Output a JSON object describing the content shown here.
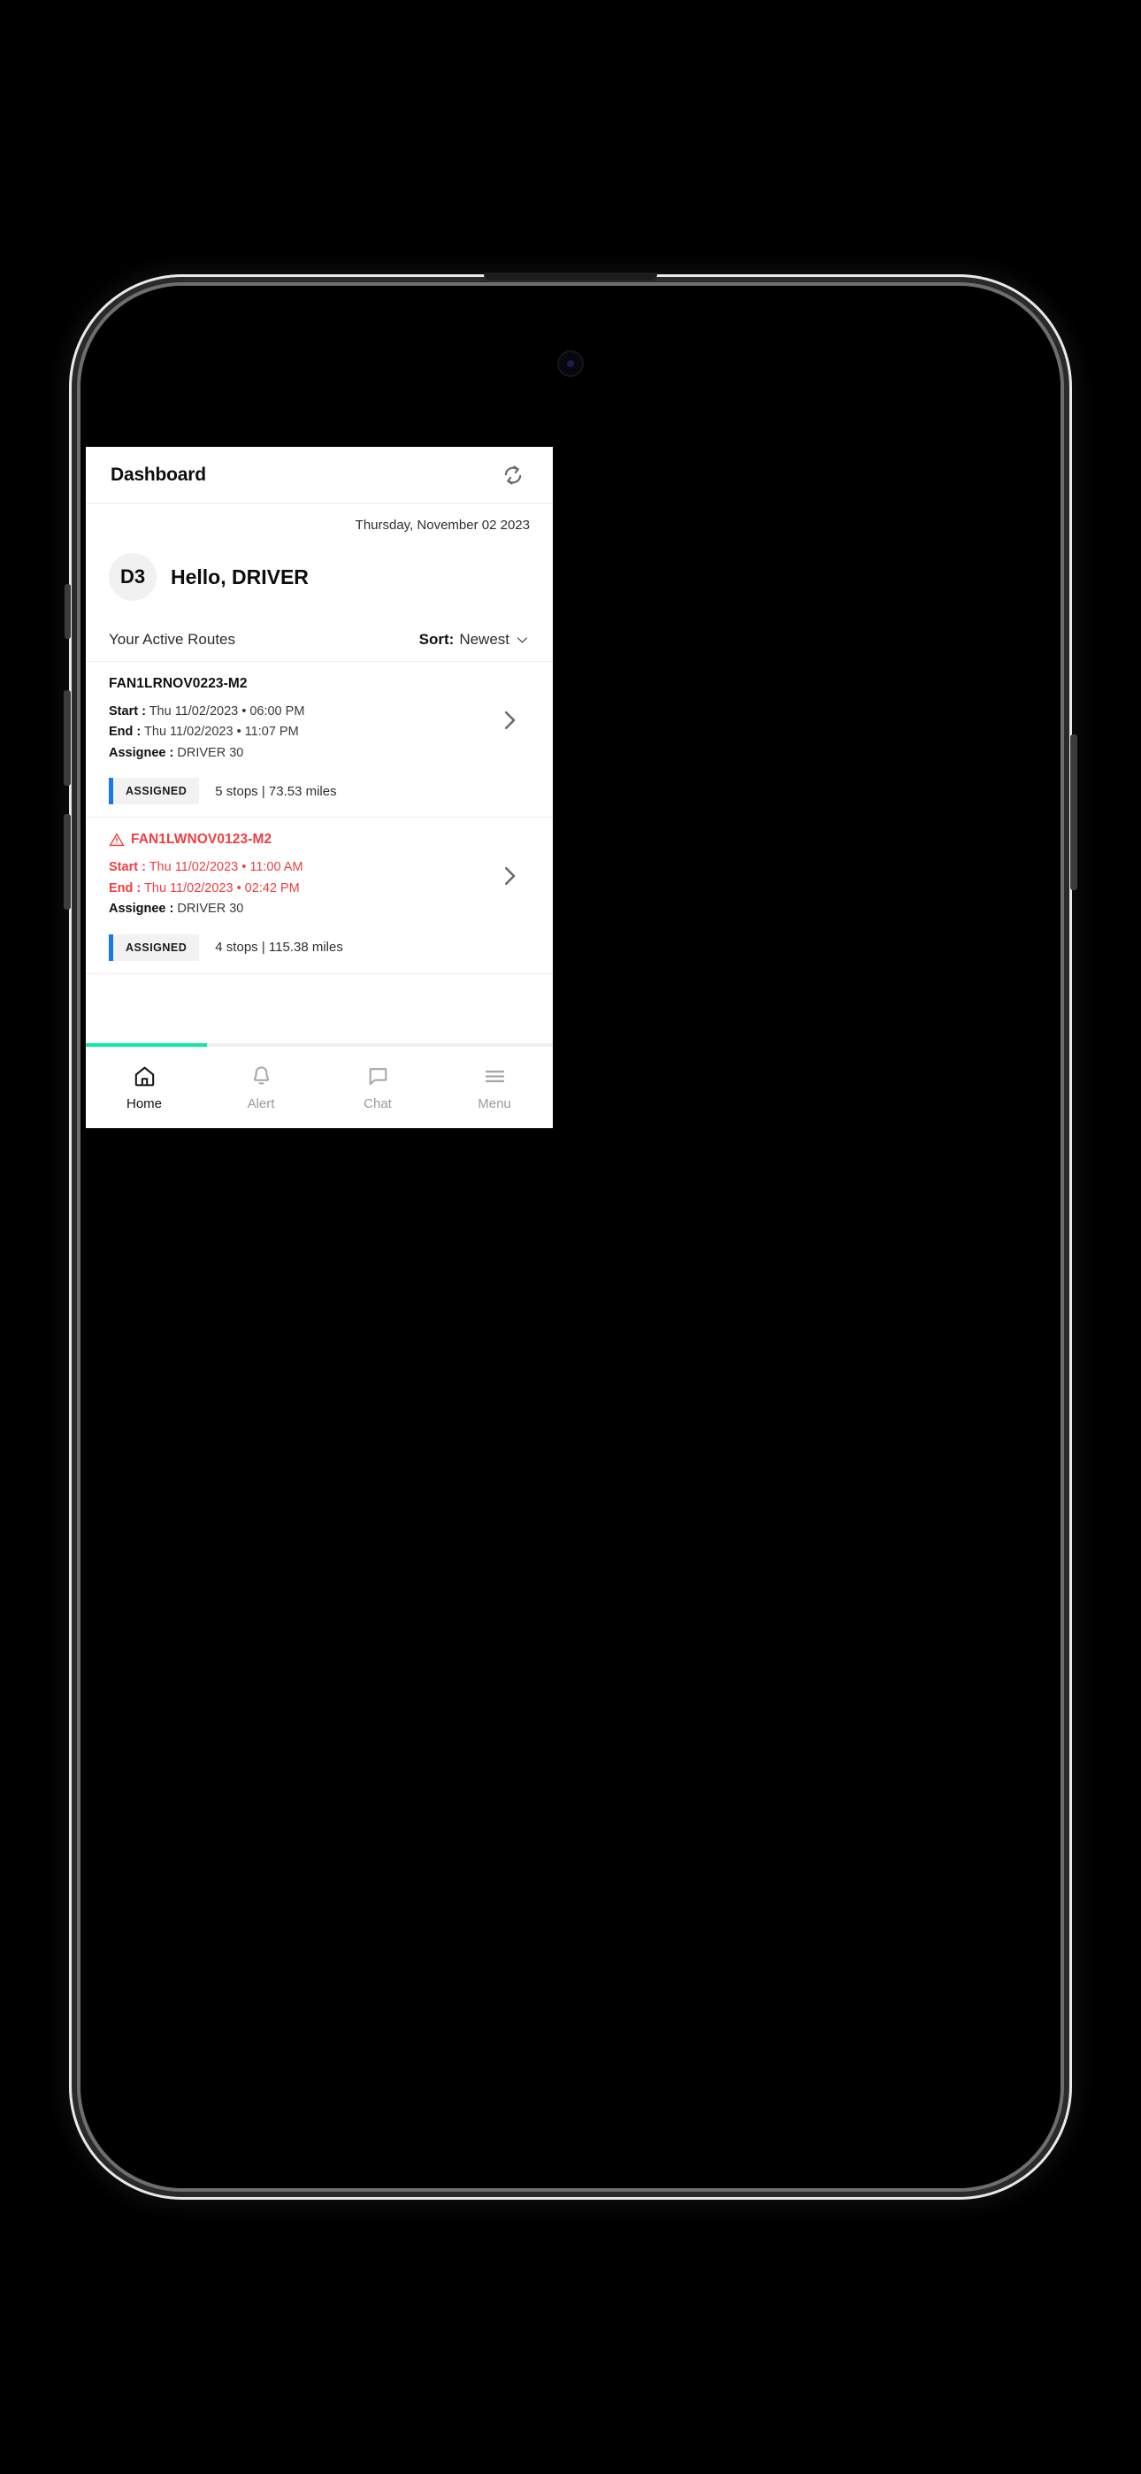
{
  "header": {
    "title": "Dashboard",
    "refresh_icon": "refresh-icon"
  },
  "current_date": "Thursday, November 02 2023",
  "user": {
    "initials": "D3",
    "greeting": "Hello, DRIVER"
  },
  "routes_toolbar": {
    "section_label": "Your Active Routes",
    "sort_label": "Sort:",
    "sort_value": "Newest",
    "sort_chevron_icon": "chevron-down-icon"
  },
  "routes": [
    {
      "id": "FAN1LRNOV0223-M2",
      "alert": false,
      "start_label": "Start :",
      "start_value": "Thu 11/02/2023 • 06:00 PM",
      "end_label": "End :",
      "end_value": "Thu 11/02/2023 • 11:07 PM",
      "assignee_label": "Assignee :",
      "assignee_value": "DRIVER 30",
      "status": "ASSIGNED",
      "status_color": "#1877f2",
      "meta": "5 stops | 73.53 miles",
      "chevron_icon": "chevron-right-icon"
    },
    {
      "id": "FAN1LWNOV0123-M2",
      "alert": true,
      "alert_icon": "warning-triangle-icon",
      "alert_color": "#ef3e42",
      "start_label": "Start :",
      "start_value": "Thu 11/02/2023 • 11:00 AM",
      "end_label": "End :",
      "end_value": "Thu 11/02/2023 • 02:42 PM",
      "assignee_label": "Assignee :",
      "assignee_value": "DRIVER 30",
      "status": "ASSIGNED",
      "status_color": "#1877f2",
      "meta": "4 stops | 115.38 miles",
      "chevron_icon": "chevron-right-icon"
    }
  ],
  "progress": {
    "percent": 26,
    "color": "#0ceaa0"
  },
  "bottom_nav": {
    "items": [
      {
        "label": "Home",
        "icon": "home-icon",
        "active": true
      },
      {
        "label": "Alert",
        "icon": "bell-icon",
        "active": false
      },
      {
        "label": "Chat",
        "icon": "chat-icon",
        "active": false
      },
      {
        "label": "Menu",
        "icon": "hamburger-icon",
        "active": false
      }
    ]
  }
}
